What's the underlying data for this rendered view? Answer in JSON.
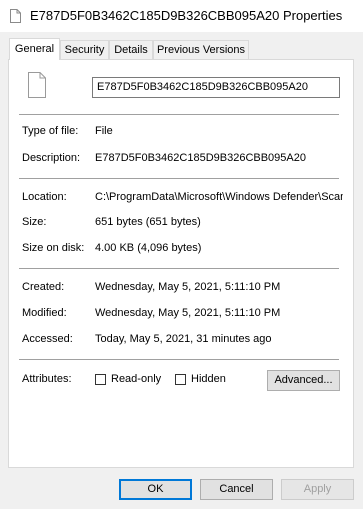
{
  "window": {
    "title": "E787D5F0B3462C185D9B326CBB095A20 Properties"
  },
  "tabs": [
    {
      "label": "General",
      "active": true
    },
    {
      "label": "Security",
      "active": false
    },
    {
      "label": "Details",
      "active": false
    },
    {
      "label": "Previous Versions",
      "active": false
    }
  ],
  "general": {
    "file_name": "E787D5F0B3462C185D9B326CBB095A20",
    "type_label": "Type of file:",
    "type_value": "File",
    "description_label": "Description:",
    "description_value": "E787D5F0B3462C185D9B326CBB095A20",
    "location_label": "Location:",
    "location_value": "C:\\ProgramData\\Microsoft\\Windows Defender\\Scans",
    "size_label": "Size:",
    "size_value": "651 bytes (651 bytes)",
    "size_on_disk_label": "Size on disk:",
    "size_on_disk_value": "4.00 KB (4,096 bytes)",
    "created_label": "Created:",
    "created_value": "Wednesday, May 5, 2021, 5:11:10 PM",
    "modified_label": "Modified:",
    "modified_value": "Wednesday, May 5, 2021, 5:11:10 PM",
    "accessed_label": "Accessed:",
    "accessed_value": "Today, May 5, 2021, 31 minutes ago",
    "attributes_label": "Attributes:",
    "readonly_label": "Read-only",
    "readonly_checked": false,
    "hidden_label": "Hidden",
    "hidden_checked": false,
    "advanced_label": "Advanced..."
  },
  "buttons": {
    "ok": "OK",
    "cancel": "Cancel",
    "apply": "Apply"
  }
}
